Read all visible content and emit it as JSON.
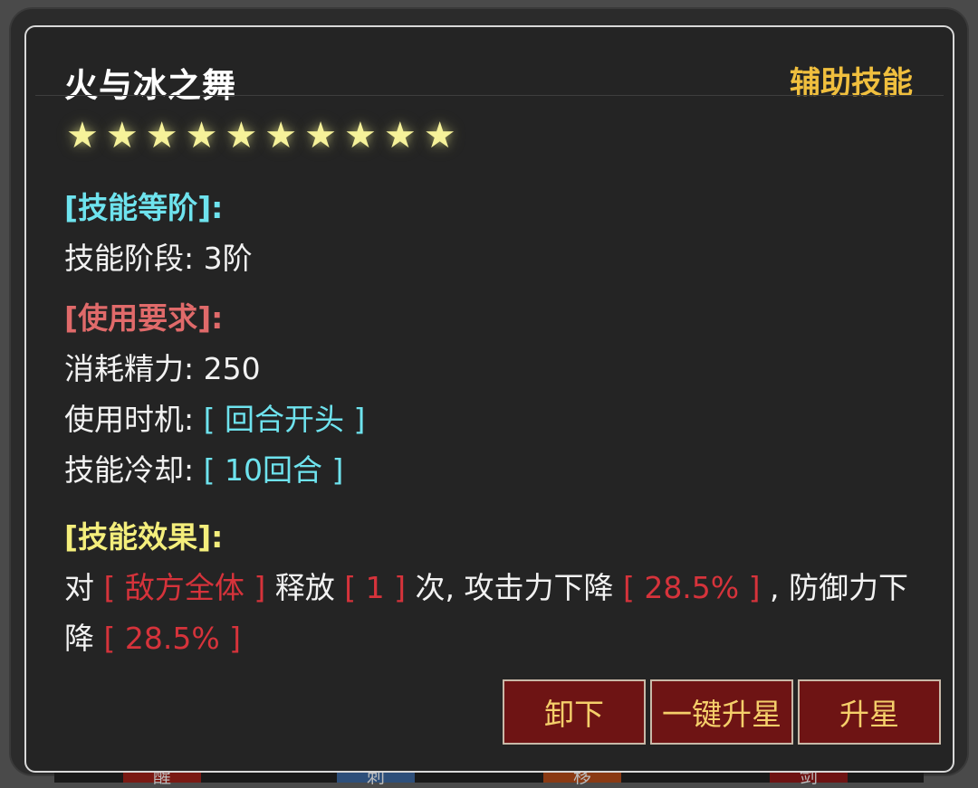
{
  "dialog": {
    "title": "火与冰之舞",
    "type_label": "辅助技能",
    "stars": [
      "★",
      "★",
      "★",
      "★",
      "★",
      "★",
      "★",
      "★",
      "★",
      "★"
    ],
    "stars_count": 10
  },
  "grade": {
    "header": "[技能等阶]:",
    "stage_label": "技能阶段:",
    "stage_value": "3阶"
  },
  "requirements": {
    "header": "[使用要求]:",
    "energy_label": "消耗精力:",
    "energy_value": "250",
    "timing_label": "使用时机:",
    "timing_value": "[ 回合开头 ]",
    "cooldown_label": "技能冷却:",
    "cooldown_value": "[ 10回合 ]"
  },
  "effect": {
    "header": "[技能效果]:",
    "p1": "对",
    "target": "[ 敌方全体 ]",
    "p2": "释放",
    "times": "[ 1 ]",
    "p3": "次, 攻击力下降",
    "atk_down": "[ 28.5% ]",
    "p4": ", 防御力下降",
    "def_down": "[ 28.5% ]"
  },
  "buttons": {
    "unequip": "卸下",
    "one_click_star": "一键升星",
    "star_up": "升星"
  },
  "bottom_strip": {
    "glyphs": [
      "醒",
      "刺",
      "移",
      "剑"
    ]
  },
  "colors": {
    "cyan": "#6ee3ee",
    "red": "#e06a6a",
    "yellow": "#f4ee7c",
    "highlight_red": "#d6333b",
    "gold": "#f0bf3e",
    "button_bg": "#6e1414",
    "button_text": "#f5cf6a"
  }
}
